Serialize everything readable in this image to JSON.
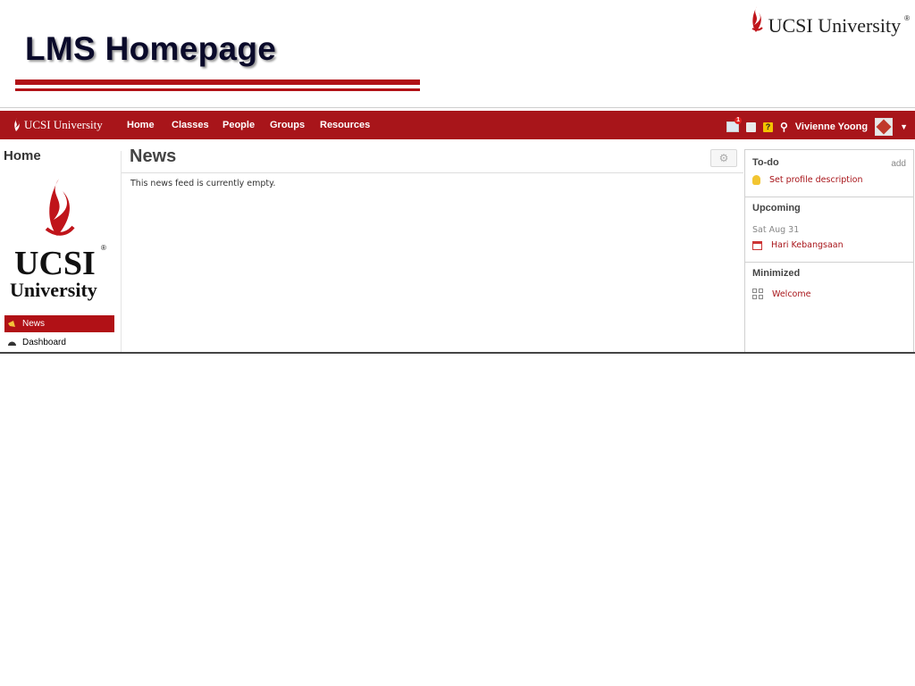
{
  "slide": {
    "title": "LMS Homepage",
    "brand": "UCSI University",
    "brand_reg": "®"
  },
  "navbar": {
    "logo_text": "UCSI University",
    "items": [
      "Home",
      "Classes",
      "People",
      "Groups",
      "Resources"
    ],
    "mail_badge": "1",
    "help_icon": "?",
    "user_name": "Vivienne Yoong"
  },
  "sidebar": {
    "title": "Home",
    "logo_main": "UCSI",
    "logo_reg": "®",
    "logo_sub": "University",
    "items": [
      {
        "label": "News",
        "icon": "megaphone-icon",
        "active": true
      },
      {
        "label": "Dashboard",
        "icon": "dashboard-icon",
        "active": false
      }
    ]
  },
  "main": {
    "title": "News",
    "empty_text": "This news feed is currently empty."
  },
  "right_panel": {
    "todo": {
      "title": "To-do",
      "add_label": "add",
      "items": [
        "Set profile description"
      ]
    },
    "upcoming": {
      "title": "Upcoming",
      "date": "Sat Aug 31",
      "items": [
        "Hari Kebangsaan"
      ]
    },
    "minimized": {
      "title": "Minimized",
      "items": [
        "Welcome"
      ]
    }
  },
  "colors": {
    "brand_red": "#a8151a",
    "accent_red": "#b11116"
  }
}
